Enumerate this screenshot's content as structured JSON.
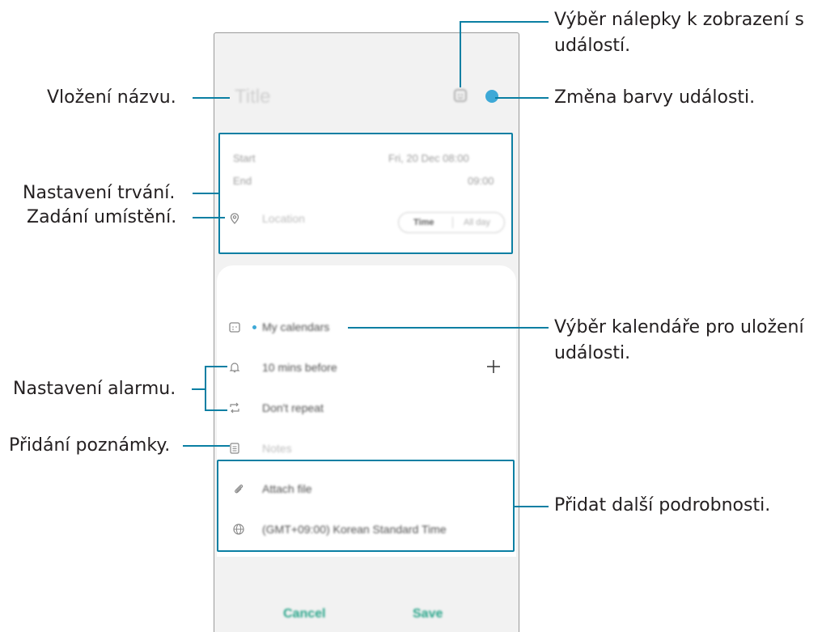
{
  "phone": {
    "title_placeholder": "Title",
    "start_label": "Start",
    "start_value": "Fri, 20 Dec   08:00",
    "end_label": "End",
    "end_value": "09:00",
    "toggle_time": "Time",
    "toggle_allday": "All day",
    "rows": {
      "location": "Location",
      "calendar": "My calendars",
      "alarm": "10 mins before",
      "repeat": "Don't repeat",
      "notes": "Notes",
      "attach": "Attach file",
      "timezone": "(GMT+09:00) Korean Standard Time"
    },
    "cancel": "Cancel",
    "save": "Save",
    "event_color": "#3ea9d7"
  },
  "callouts": {
    "title": "Vložení názvu.",
    "duration": "Nastavení trvání.",
    "location": "Zadání umístění.",
    "alarm": "Nastavení alarmu.",
    "notes": "Přidání poznámky.",
    "sticker_line1": "Výběr nálepky k zobrazení s",
    "sticker_line2": "událostí.",
    "color": "Změna barvy události.",
    "calendar_line1": "Výběr kalendáře pro uložení",
    "calendar_line2": "události.",
    "more": "Přidat další podrobnosti."
  },
  "accent_color": "#0a7fa3"
}
